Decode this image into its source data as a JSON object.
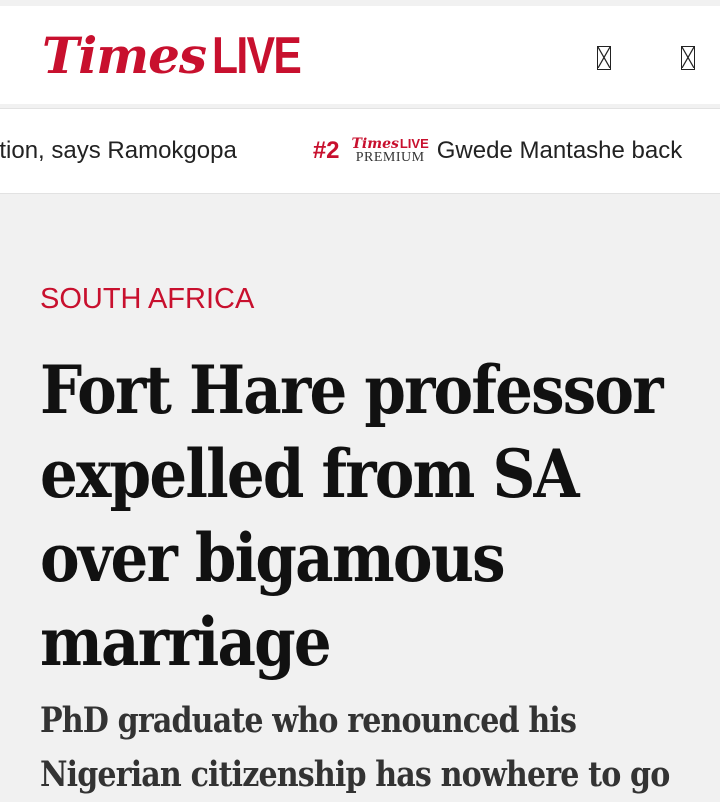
{
  "header": {
    "logo_times": "Times",
    "logo_live": "LIVE",
    "icons": [
      "search-icon",
      "menu-icon"
    ],
    "brand_color": "#c8102e"
  },
  "ticker": {
    "items": [
      {
        "rank": "",
        "text": "ation, says Ramokgopa",
        "premium": false
      },
      {
        "rank": "#2",
        "text": "Gwede Mantashe back",
        "premium": true,
        "badge_top": "TimesLIVE",
        "badge_sub": "PREMIUM"
      }
    ]
  },
  "article": {
    "section": "SOUTH AFRICA",
    "headline": "Fort Hare professor expelled from SA over bigamous marriage",
    "standfirst": "PhD graduate who renounced his Nigerian citizenship has nowhere to go"
  }
}
